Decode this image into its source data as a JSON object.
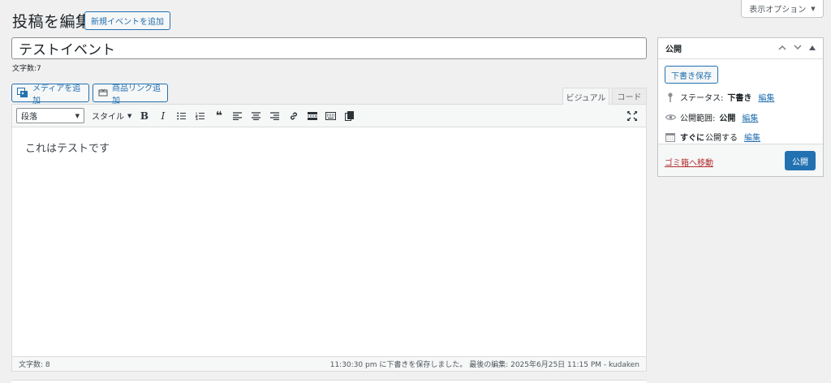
{
  "screen_options": {
    "label": "表示オプション"
  },
  "header": {
    "title": "投稿を編集",
    "add_new_label": "新規イベントを追加"
  },
  "post_title": {
    "value": "テストイベント",
    "char_count": "文字数:7"
  },
  "media_buttons": {
    "add_media": "メディアを追加",
    "product_link": "商品リンク追加"
  },
  "editor_tabs": {
    "visual": "ビジュアル",
    "code": "コード"
  },
  "toolbar": {
    "format_select": "段落",
    "style_menu": "スタイル",
    "buttons": [
      {
        "name": "bold-icon",
        "glyph": "B"
      },
      {
        "name": "italic-icon",
        "glyph": "I"
      },
      {
        "name": "bullet-list-icon",
        "glyph": "≔"
      },
      {
        "name": "numbered-list-icon",
        "glyph": "⒈"
      },
      {
        "name": "blockquote-icon",
        "glyph": "❝"
      },
      {
        "name": "align-left-icon",
        "glyph": "≡"
      },
      {
        "name": "align-center-icon",
        "glyph": "≡"
      },
      {
        "name": "align-right-icon",
        "glyph": "≡"
      },
      {
        "name": "link-icon",
        "glyph": "🔗"
      },
      {
        "name": "read-more-icon",
        "glyph": "▭"
      },
      {
        "name": "toolbar-toggle-icon",
        "glyph": "⌨"
      },
      {
        "name": "paste-icon",
        "glyph": "❐"
      }
    ]
  },
  "editor": {
    "content": "これはテストです",
    "word_count": "文字数: 8",
    "last_saved": "11:30:30 pm に下書きを保存しました。 最後の編集: 2025年6月25日 11:15 PM - kudaken"
  },
  "publish_box": {
    "title": "公開",
    "save_draft_label": "下書き保存",
    "status_label": "ステータス:",
    "status_value": "下書き",
    "visibility_label": "公開範囲:",
    "visibility_value": "公開",
    "schedule_label": "すぐに",
    "schedule_suffix": "公開する",
    "edit_label": "編集",
    "trash_label": "ゴミ箱へ移動",
    "publish_label": "公開"
  },
  "colors": {
    "accent": "#2271b1",
    "danger": "#b32d2e",
    "background": "#f0f0f1"
  }
}
